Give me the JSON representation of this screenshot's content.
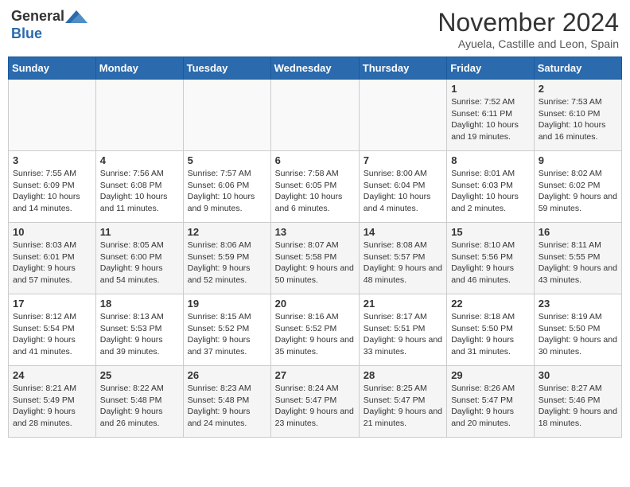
{
  "logo": {
    "line1": "General",
    "line2": "Blue"
  },
  "title": "November 2024",
  "location": "Ayuela, Castille and Leon, Spain",
  "weekdays": [
    "Sunday",
    "Monday",
    "Tuesday",
    "Wednesday",
    "Thursday",
    "Friday",
    "Saturday"
  ],
  "weeks": [
    [
      {
        "day": "",
        "info": ""
      },
      {
        "day": "",
        "info": ""
      },
      {
        "day": "",
        "info": ""
      },
      {
        "day": "",
        "info": ""
      },
      {
        "day": "",
        "info": ""
      },
      {
        "day": "1",
        "info": "Sunrise: 7:52 AM\nSunset: 6:11 PM\nDaylight: 10 hours and 19 minutes."
      },
      {
        "day": "2",
        "info": "Sunrise: 7:53 AM\nSunset: 6:10 PM\nDaylight: 10 hours and 16 minutes."
      }
    ],
    [
      {
        "day": "3",
        "info": "Sunrise: 7:55 AM\nSunset: 6:09 PM\nDaylight: 10 hours and 14 minutes."
      },
      {
        "day": "4",
        "info": "Sunrise: 7:56 AM\nSunset: 6:08 PM\nDaylight: 10 hours and 11 minutes."
      },
      {
        "day": "5",
        "info": "Sunrise: 7:57 AM\nSunset: 6:06 PM\nDaylight: 10 hours and 9 minutes."
      },
      {
        "day": "6",
        "info": "Sunrise: 7:58 AM\nSunset: 6:05 PM\nDaylight: 10 hours and 6 minutes."
      },
      {
        "day": "7",
        "info": "Sunrise: 8:00 AM\nSunset: 6:04 PM\nDaylight: 10 hours and 4 minutes."
      },
      {
        "day": "8",
        "info": "Sunrise: 8:01 AM\nSunset: 6:03 PM\nDaylight: 10 hours and 2 minutes."
      },
      {
        "day": "9",
        "info": "Sunrise: 8:02 AM\nSunset: 6:02 PM\nDaylight: 9 hours and 59 minutes."
      }
    ],
    [
      {
        "day": "10",
        "info": "Sunrise: 8:03 AM\nSunset: 6:01 PM\nDaylight: 9 hours and 57 minutes."
      },
      {
        "day": "11",
        "info": "Sunrise: 8:05 AM\nSunset: 6:00 PM\nDaylight: 9 hours and 54 minutes."
      },
      {
        "day": "12",
        "info": "Sunrise: 8:06 AM\nSunset: 5:59 PM\nDaylight: 9 hours and 52 minutes."
      },
      {
        "day": "13",
        "info": "Sunrise: 8:07 AM\nSunset: 5:58 PM\nDaylight: 9 hours and 50 minutes."
      },
      {
        "day": "14",
        "info": "Sunrise: 8:08 AM\nSunset: 5:57 PM\nDaylight: 9 hours and 48 minutes."
      },
      {
        "day": "15",
        "info": "Sunrise: 8:10 AM\nSunset: 5:56 PM\nDaylight: 9 hours and 46 minutes."
      },
      {
        "day": "16",
        "info": "Sunrise: 8:11 AM\nSunset: 5:55 PM\nDaylight: 9 hours and 43 minutes."
      }
    ],
    [
      {
        "day": "17",
        "info": "Sunrise: 8:12 AM\nSunset: 5:54 PM\nDaylight: 9 hours and 41 minutes."
      },
      {
        "day": "18",
        "info": "Sunrise: 8:13 AM\nSunset: 5:53 PM\nDaylight: 9 hours and 39 minutes."
      },
      {
        "day": "19",
        "info": "Sunrise: 8:15 AM\nSunset: 5:52 PM\nDaylight: 9 hours and 37 minutes."
      },
      {
        "day": "20",
        "info": "Sunrise: 8:16 AM\nSunset: 5:52 PM\nDaylight: 9 hours and 35 minutes."
      },
      {
        "day": "21",
        "info": "Sunrise: 8:17 AM\nSunset: 5:51 PM\nDaylight: 9 hours and 33 minutes."
      },
      {
        "day": "22",
        "info": "Sunrise: 8:18 AM\nSunset: 5:50 PM\nDaylight: 9 hours and 31 minutes."
      },
      {
        "day": "23",
        "info": "Sunrise: 8:19 AM\nSunset: 5:50 PM\nDaylight: 9 hours and 30 minutes."
      }
    ],
    [
      {
        "day": "24",
        "info": "Sunrise: 8:21 AM\nSunset: 5:49 PM\nDaylight: 9 hours and 28 minutes."
      },
      {
        "day": "25",
        "info": "Sunrise: 8:22 AM\nSunset: 5:48 PM\nDaylight: 9 hours and 26 minutes."
      },
      {
        "day": "26",
        "info": "Sunrise: 8:23 AM\nSunset: 5:48 PM\nDaylight: 9 hours and 24 minutes."
      },
      {
        "day": "27",
        "info": "Sunrise: 8:24 AM\nSunset: 5:47 PM\nDaylight: 9 hours and 23 minutes."
      },
      {
        "day": "28",
        "info": "Sunrise: 8:25 AM\nSunset: 5:47 PM\nDaylight: 9 hours and 21 minutes."
      },
      {
        "day": "29",
        "info": "Sunrise: 8:26 AM\nSunset: 5:47 PM\nDaylight: 9 hours and 20 minutes."
      },
      {
        "day": "30",
        "info": "Sunrise: 8:27 AM\nSunset: 5:46 PM\nDaylight: 9 hours and 18 minutes."
      }
    ]
  ]
}
